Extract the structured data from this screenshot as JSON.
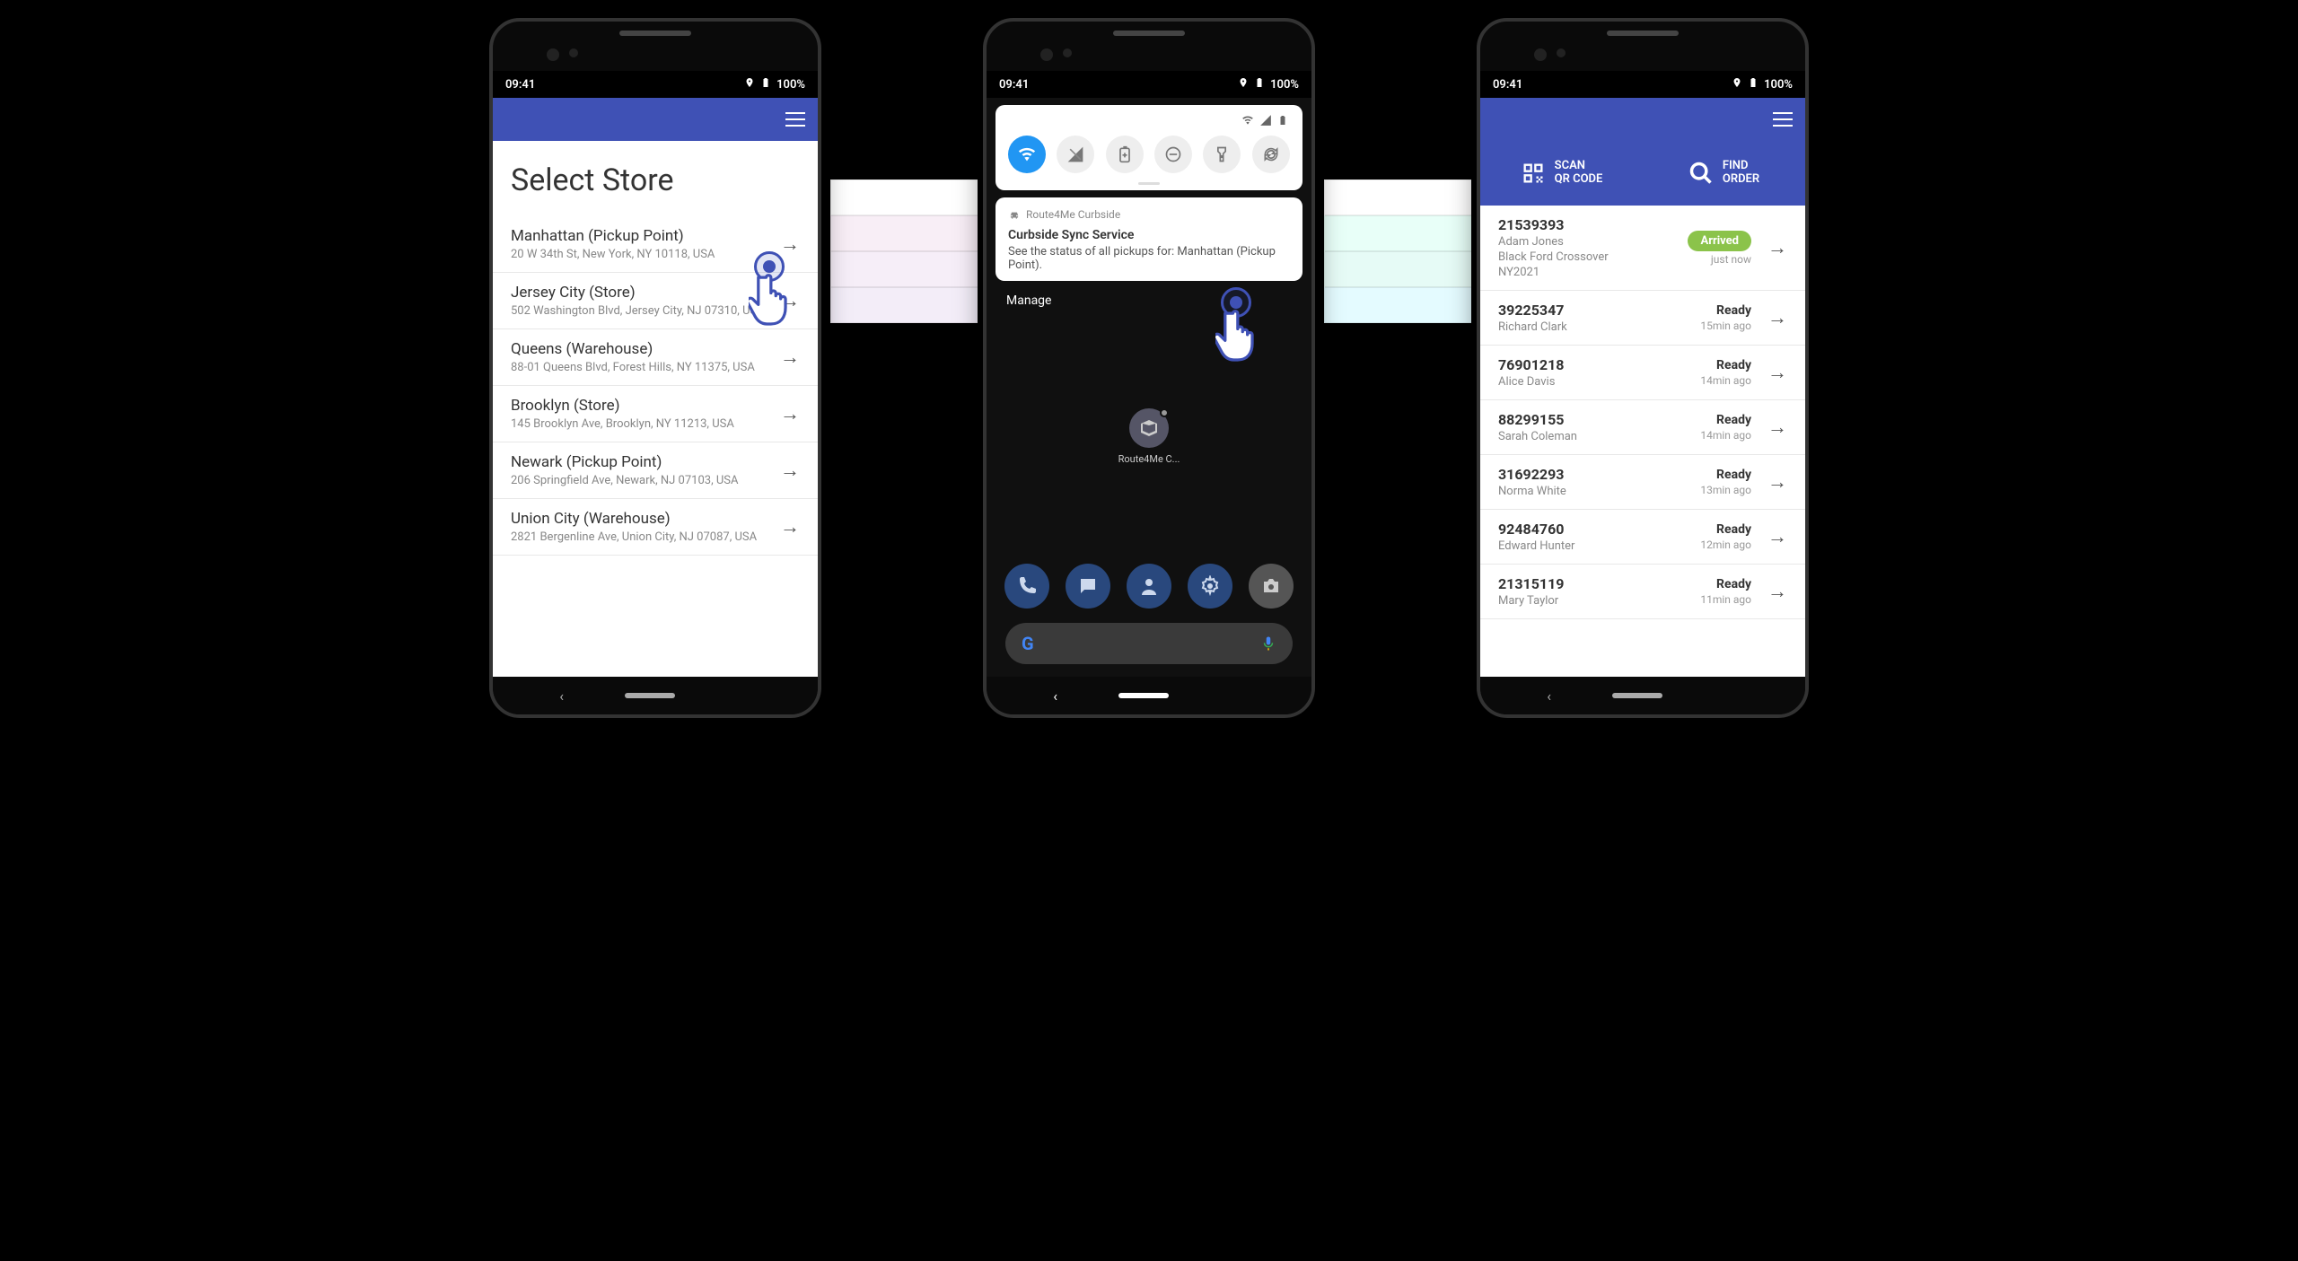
{
  "status": {
    "time": "09:41",
    "battery": "100%"
  },
  "phone1": {
    "title": "Select Store",
    "stores": [
      {
        "name": "Manhattan (Pickup Point)",
        "addr": "20 W 34th St, New York, NY 10118, USA"
      },
      {
        "name": "Jersey City (Store)",
        "addr": "502 Washington Blvd, Jersey City, NJ 07310, USA"
      },
      {
        "name": "Queens (Warehouse)",
        "addr": "88-01 Queens Blvd, Forest Hills, NY 11375, USA"
      },
      {
        "name": "Brooklyn (Store)",
        "addr": "145 Brooklyn Ave, Brooklyn, NY 11213, USA"
      },
      {
        "name": "Newark (Pickup Point)",
        "addr": "206 Springfield Ave, Newark, NJ 07103, USA"
      },
      {
        "name": "Union City (Warehouse)",
        "addr": "2821 Bergenline Ave, Union City, NJ 07087, USA"
      }
    ]
  },
  "phone2": {
    "notification": {
      "app": "Route4Me Curbside",
      "title": "Curbside Sync Service",
      "body": "See the status of all pickups for: Manhattan (Pickup Point).",
      "manage": "Manage"
    },
    "app_label": "Route4Me C..."
  },
  "phone3": {
    "actions": {
      "scan_l1": "SCAN",
      "scan_l2": "QR CODE",
      "find_l1": "FIND",
      "find_l2": "ORDER"
    },
    "orders": [
      {
        "num": "21539393",
        "sub1": "Adam Jones",
        "sub2": "Black Ford Crossover",
        "sub3": "NY2021",
        "status": "Arrived",
        "when": "just now",
        "arrived": true
      },
      {
        "num": "39225347",
        "sub1": "Richard Clark",
        "status": "Ready",
        "when": "15min ago"
      },
      {
        "num": "76901218",
        "sub1": "Alice Davis",
        "status": "Ready",
        "when": "14min ago"
      },
      {
        "num": "88299155",
        "sub1": "Sarah Coleman",
        "status": "Ready",
        "when": "14min ago"
      },
      {
        "num": "31692293",
        "sub1": "Norma White",
        "status": "Ready",
        "when": "13min ago"
      },
      {
        "num": "92484760",
        "sub1": "Edward Hunter",
        "status": "Ready",
        "when": "12min ago"
      },
      {
        "num": "21315119",
        "sub1": "Mary Taylor",
        "status": "Ready",
        "when": "11min ago"
      }
    ]
  }
}
